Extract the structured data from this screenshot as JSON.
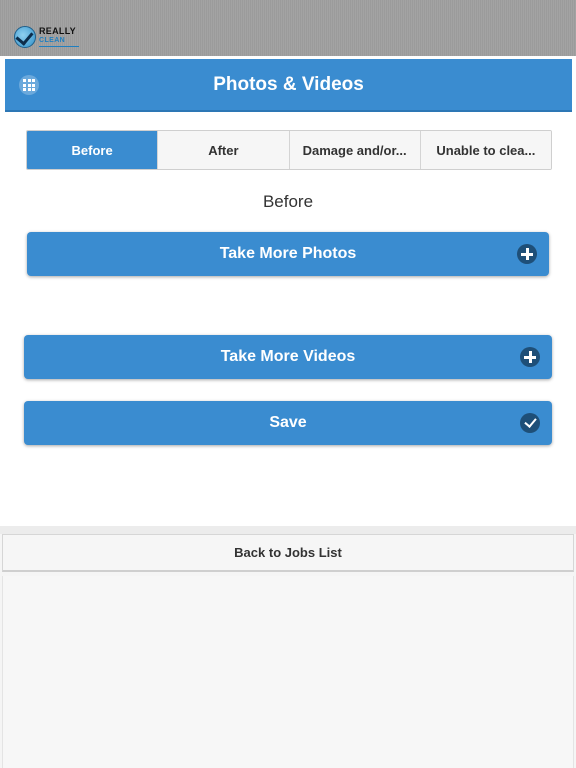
{
  "header": {
    "logo": {
      "line1": "REALLY",
      "line2": "CLEAN"
    }
  },
  "title_bar": {
    "title": "Photos & Videos",
    "menu_icon": "grid-icon"
  },
  "tabs": [
    {
      "label": "Before",
      "active": true
    },
    {
      "label": "After",
      "active": false
    },
    {
      "label": "Damage and/or...",
      "active": false
    },
    {
      "label": "Unable to clea...",
      "active": false
    }
  ],
  "section_label": "Before",
  "buttons": {
    "take_photos": {
      "label": "Take More Photos",
      "icon": "plus-circle-icon"
    },
    "take_videos": {
      "label": "Take More Videos",
      "icon": "plus-circle-icon"
    },
    "save": {
      "label": "Save",
      "icon": "check-circle-icon"
    }
  },
  "footer": {
    "back_label": "Back to Jobs List"
  },
  "colors": {
    "accent": "#3a8cd0",
    "icon_dark": "#1e4f78",
    "header_grey": "#9e9e9e"
  }
}
